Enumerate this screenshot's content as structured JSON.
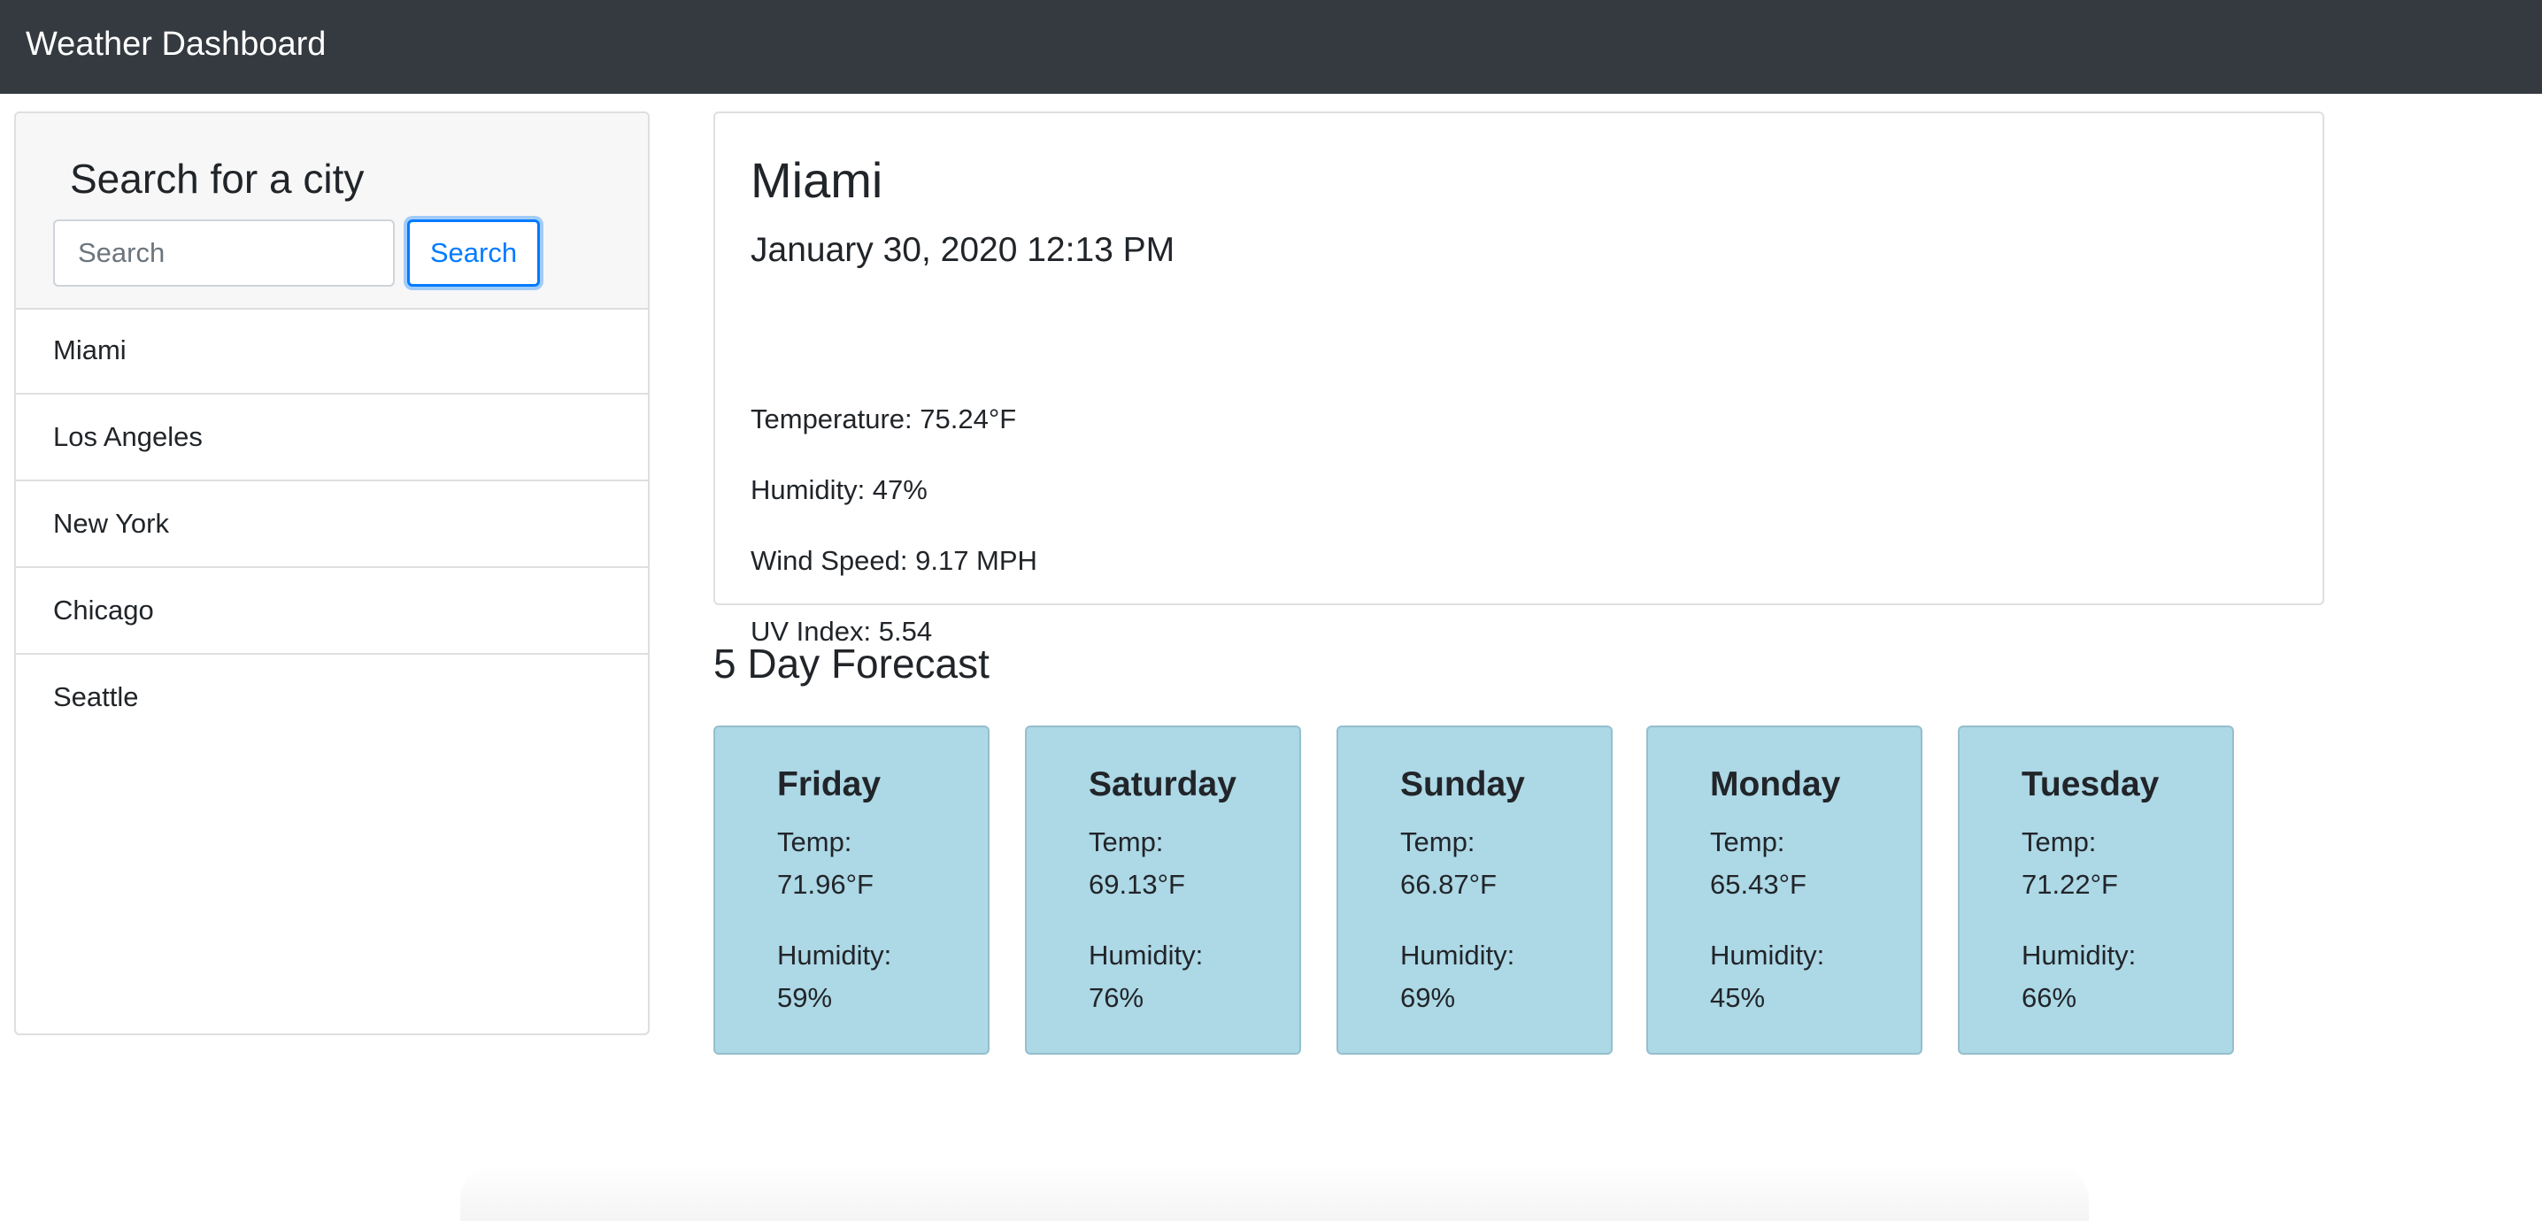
{
  "navbar": {
    "brand": "Weather Dashboard"
  },
  "sidebar": {
    "title": "Search for a city",
    "search": {
      "placeholder": "Search",
      "value": "",
      "button_label": "Search"
    },
    "cities": [
      "Miami",
      "Los Angeles",
      "New York",
      "Chicago",
      "Seattle"
    ]
  },
  "current": {
    "city": "Miami",
    "date": "January 30, 2020 12:13 PM",
    "temperature": "Temperature: 75.24°F",
    "humidity": "Humidity: 47%",
    "wind_speed": "Wind Speed: 9.17 MPH",
    "uv_index": "UV Index: 5.54"
  },
  "forecast": {
    "title": "5 Day Forecast",
    "temp_label": "Temp:",
    "humidity_label": "Humidity:",
    "days": [
      {
        "day": "Friday",
        "temp": "71.96°F",
        "humidity": "59%"
      },
      {
        "day": "Saturday",
        "temp": "69.13°F",
        "humidity": "76%"
      },
      {
        "day": "Sunday",
        "temp": "66.87°F",
        "humidity": "69%"
      },
      {
        "day": "Monday",
        "temp": "65.43°F",
        "humidity": "45%"
      },
      {
        "day": "Tuesday",
        "temp": "71.22°F",
        "humidity": "66%"
      }
    ]
  },
  "colors": {
    "navbar_bg": "#343a40",
    "accent": "#007bff",
    "forecast_card_bg": "#add8e6"
  }
}
